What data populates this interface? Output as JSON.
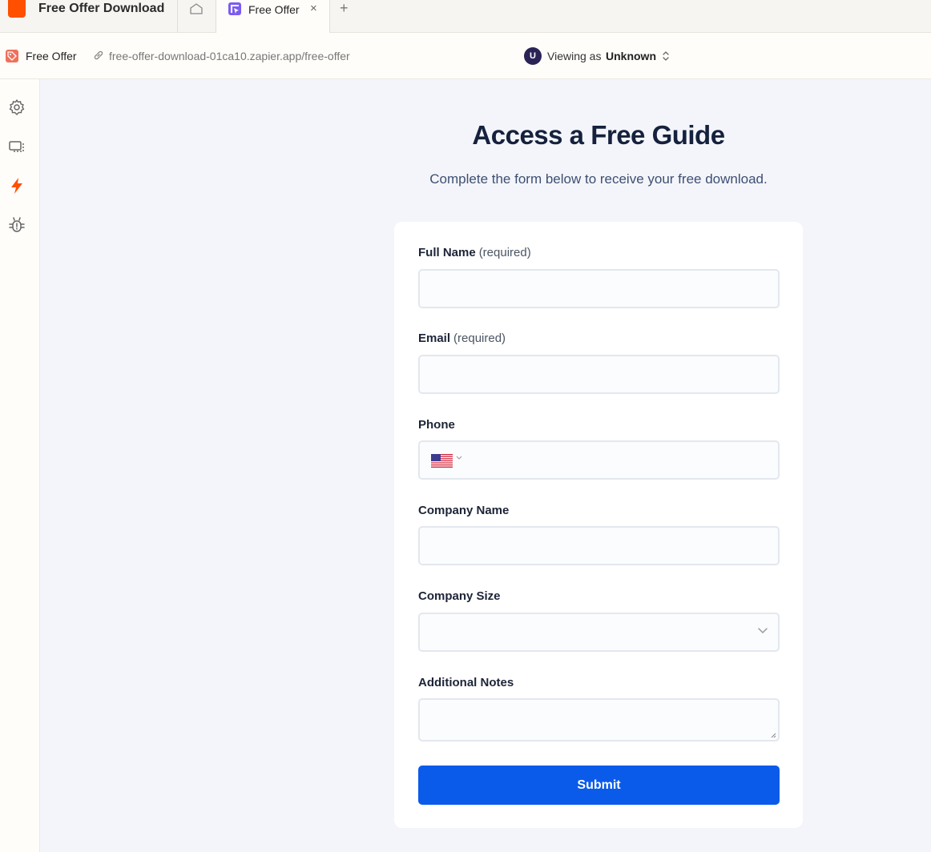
{
  "app": {
    "title": "Free Offer Download"
  },
  "tabs": [
    {
      "label": "Free Offer",
      "close": "×"
    }
  ],
  "add_tab": "+",
  "toolbar": {
    "page_name": "Free Offer",
    "url": "free-offer-download-01ca10.zapier.app/free-offer",
    "viewer": {
      "avatar": "U",
      "prefix": "Viewing as",
      "name": "Unknown"
    }
  },
  "sidebar": {
    "items": [
      {
        "name": "settings",
        "icon": "gear-icon"
      },
      {
        "name": "pages",
        "icon": "screens-icon"
      },
      {
        "name": "zaps",
        "icon": "lightning-icon"
      },
      {
        "name": "debug",
        "icon": "bug-icon"
      }
    ]
  },
  "form": {
    "heading": "Access a Free Guide",
    "subheading": "Complete the form below to receive your free download.",
    "fields": [
      {
        "label": "Full Name",
        "required": "(required)",
        "type": "text",
        "value": ""
      },
      {
        "label": "Email",
        "required": "(required)",
        "type": "text",
        "value": ""
      },
      {
        "label": "Phone",
        "required": "",
        "type": "phone",
        "value": "",
        "country": "US"
      },
      {
        "label": "Company Name",
        "required": "",
        "type": "text",
        "value": ""
      },
      {
        "label": "Company Size",
        "required": "",
        "type": "select",
        "value": ""
      },
      {
        "label": "Additional Notes",
        "required": "",
        "type": "textarea",
        "value": ""
      }
    ],
    "submit_label": "Submit"
  },
  "colors": {
    "brand": "#ff4f00",
    "submit": "#0a5bea",
    "heading": "#15213d",
    "background": "#f4f5fa"
  }
}
